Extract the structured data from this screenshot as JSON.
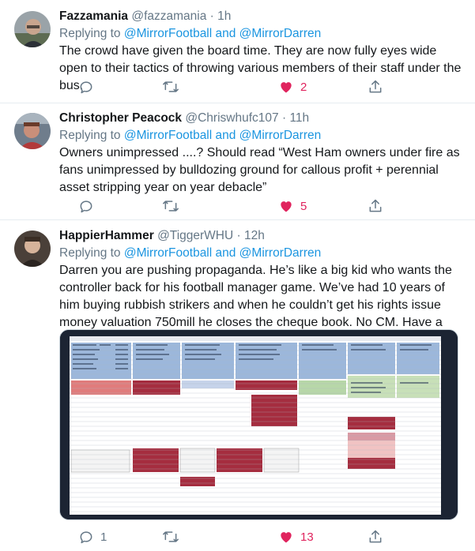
{
  "tweets": [
    {
      "name": "Fazzamania",
      "handle": "@fazzamania",
      "separator": "·",
      "time": "1h",
      "reply_prefix": "Replying to",
      "reply_to": "@MirrorFootball and @MirrorDarren",
      "text": "The crowd have given the board time. They are now fully eyes wide open to their tactics of throwing various members of their staff under the bus.",
      "replies": "",
      "retweets": "",
      "likes": "2",
      "liked": true
    },
    {
      "name": "Christopher Peacock",
      "handle": "@Chriswhufc107",
      "separator": "·",
      "time": "11h",
      "reply_prefix": "Replying to",
      "reply_to": "@MirrorFootball and @MirrorDarren",
      "text": "Owners unimpressed ....? Should read “West Ham owners under fire as fans unimpressed by bulldozing ground for callous profit + perennial asset stripping year on year debacle”",
      "replies": "",
      "retweets": "",
      "likes": "5",
      "liked": true
    },
    {
      "name": "HappierHammer",
      "handle": "@TiggerWHU",
      "separator": "·",
      "time": "12h",
      "reply_prefix": "Replying to",
      "reply_to": "@MirrorFootball and @MirrorDarren",
      "text": "Darren you are pushing propaganda. He’s like a big kid who wants the controller back for his football manager game. We’ve had 10 years of him buying rubbish strikers and when he couldn’t get his rights issue money valuation 750mill he closes the cheque book. No CM. Have a look",
      "replies": "1",
      "retweets": "",
      "likes": "13",
      "liked": true
    }
  ],
  "icons": {
    "reply": "reply-icon",
    "retweet": "retweet-icon",
    "like": "heart-icon",
    "share": "share-icon"
  },
  "colors": {
    "text": "#14171a",
    "secondary": "#657786",
    "link": "#1b95e0",
    "like": "#e0245e",
    "divider": "#e6ecf0"
  },
  "attached_image": "spreadsheet-screenshot"
}
